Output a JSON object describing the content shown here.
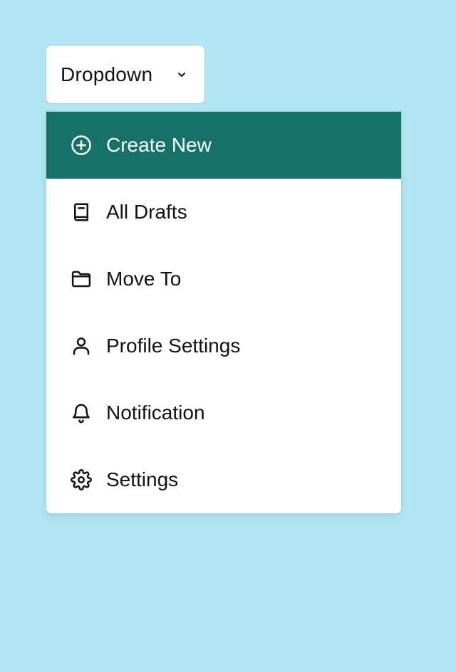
{
  "dropdown": {
    "label": "Dropdown",
    "toggle_icon": "chevron-down-icon"
  },
  "menu": {
    "items": [
      {
        "label": "Create New",
        "icon": "plus-circle-icon",
        "active": true
      },
      {
        "label": "All Drafts",
        "icon": "book-icon",
        "active": false
      },
      {
        "label": "Move To",
        "icon": "folder-icon",
        "active": false
      },
      {
        "label": "Profile Settings",
        "icon": "user-icon",
        "active": false
      },
      {
        "label": "Notification",
        "icon": "bell-icon",
        "active": false
      },
      {
        "label": "Settings",
        "icon": "gear-icon",
        "active": false
      }
    ]
  },
  "colors": {
    "background": "#b2e5f3",
    "active_item": "#167168",
    "surface": "#ffffff",
    "text": "#111111"
  }
}
